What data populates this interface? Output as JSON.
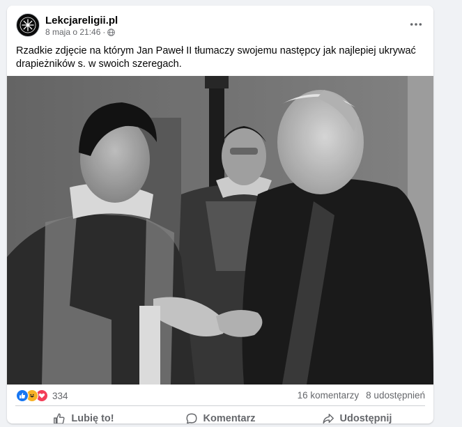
{
  "post": {
    "page_name": "Lekcjareligii.pl",
    "timestamp": "8 maja o 21:46",
    "separator": "·",
    "text": "Rzadkie zdjęcie na którym Jan Paweł II tłumaczy swojemu następcy jak najlepiej ukrywać drapieżników s. w swoich szeregach.",
    "photo_alt": "Czarno-białe zdjęcie trzech duchownych"
  },
  "icons": {
    "avatar": "emblem-icon",
    "privacy": "globe-icon",
    "more": "more-options-icon",
    "like": "thumbs-up-icon",
    "comment": "comment-icon",
    "share": "share-icon"
  },
  "stats": {
    "reaction_count": "334",
    "comments": "16 komentarzy",
    "shares": "8 udostępnień"
  },
  "actions": {
    "like": "Lubię to!",
    "comment": "Komentarz",
    "share": "Udostępnij"
  },
  "colors": {
    "like_reaction": "#1877f2",
    "haha_reaction": "#f7b125",
    "love_reaction": "#f33e58",
    "secondary_text": "#65676b"
  }
}
